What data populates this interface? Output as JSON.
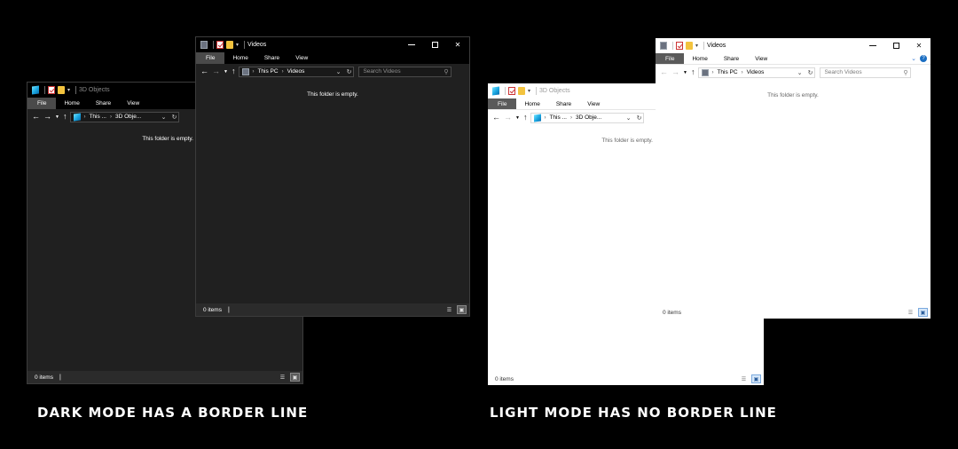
{
  "captions": {
    "dark": "DARK MODE HAS A BORDER LINE",
    "light": "LIGHT MODE HAS NO BORDER LINE"
  },
  "ribbon_tabs": {
    "file": "File",
    "home": "Home",
    "share": "Share",
    "view": "View"
  },
  "windows": {
    "dark_back": {
      "title": "3D Objects",
      "breadcrumb": [
        "This ...",
        "3D Obje..."
      ],
      "empty_text": "This folder is empty.",
      "status": "0 items"
    },
    "dark_front": {
      "title": "Videos",
      "breadcrumb": [
        "This PC",
        "Videos"
      ],
      "search_placeholder": "Search Videos",
      "empty_text": "This folder is empty.",
      "status": "0 items"
    },
    "light_back": {
      "title": "3D Objects",
      "breadcrumb": [
        "This ...",
        "3D Obje..."
      ],
      "empty_text": "This folder is empty.",
      "status": "0 items"
    },
    "light_front": {
      "title": "Videos",
      "breadcrumb": [
        "This PC",
        "Videos"
      ],
      "search_placeholder": "Search Videos",
      "empty_text": "This folder is empty.",
      "status": "0 items"
    }
  },
  "icons": {
    "back": "back-arrow-icon",
    "forward": "forward-arrow-icon",
    "recent": "recent-locations-icon",
    "up": "up-arrow-icon",
    "refresh": "refresh-icon",
    "search": "search-icon",
    "details_view": "details-view-icon",
    "large_icons_view": "large-icons-view-icon"
  },
  "colors": {
    "dark_window_bg": "#202020",
    "dark_border": "#3c3c3c",
    "light_window_bg": "#ffffff",
    "background": "#000000"
  }
}
